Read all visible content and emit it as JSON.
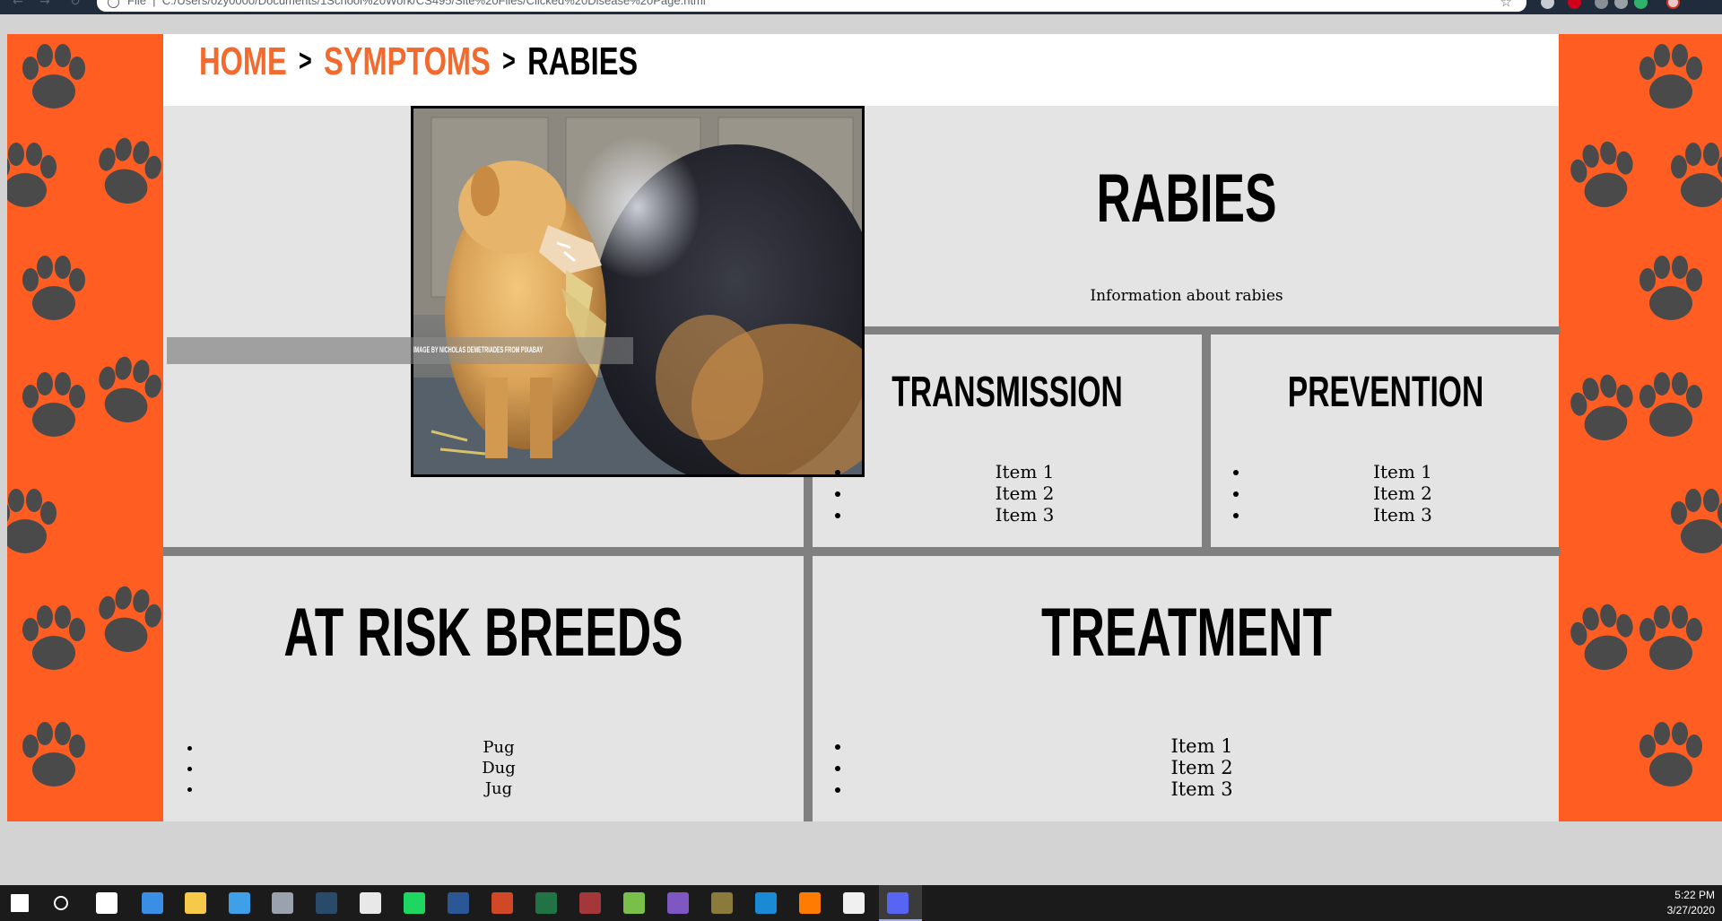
{
  "browser": {
    "address_label": "File",
    "address_path": "C:/Users/ozy0000/Documents/1School%20Work/CS495/Site%20Files/Clicked%20Disease%20Page.html"
  },
  "breadcrumb": {
    "home": "HOME",
    "symptoms": "SYMPTOMS",
    "current": "RABIES",
    "separator": ">"
  },
  "photo": {
    "caption": "IMAGE BY NICHOLAS DEMETRIADES FROM PIXABAY"
  },
  "rabies": {
    "title": "RABIES",
    "description": "Information about rabies"
  },
  "transmission": {
    "title": "TRANSMISSION",
    "items": [
      "Item 1",
      "Item 2",
      "Item 3"
    ]
  },
  "prevention": {
    "title": "PREVENTION",
    "items": [
      "Item 1",
      "Item 2",
      "Item 3"
    ]
  },
  "at_risk": {
    "title": "AT RISK BREEDS",
    "items": [
      "Pug",
      "Dug",
      "Jug"
    ]
  },
  "treatment": {
    "title": "TREATMENT",
    "items": [
      "Item 1",
      "Item 2",
      "Item 3"
    ]
  },
  "taskbar": {
    "time": "5:22 PM",
    "date": "3/27/2020",
    "apps": [
      "start-icon",
      "search-icon",
      "task-view-icon",
      "tablet-app-icon",
      "file-explorer-icon",
      "dev-tool-icon",
      "droplet-app-icon",
      "steam-icon",
      "chrome-icon",
      "spotify-icon",
      "word-icon",
      "powerpoint-icon",
      "excel-icon",
      "access-icon",
      "project-icon",
      "visual-studio-icon",
      "game-launcher-icon",
      "vscode-icon",
      "illustrator-icon",
      "photos-icon",
      "discord-icon"
    ]
  },
  "colors": {
    "accent_orange": "#ff5d22",
    "link_orange": "#f26a2e",
    "panel_gray": "#e4e4e4",
    "divider_gray": "#808080",
    "paw_gray": "#4a4a4a"
  }
}
